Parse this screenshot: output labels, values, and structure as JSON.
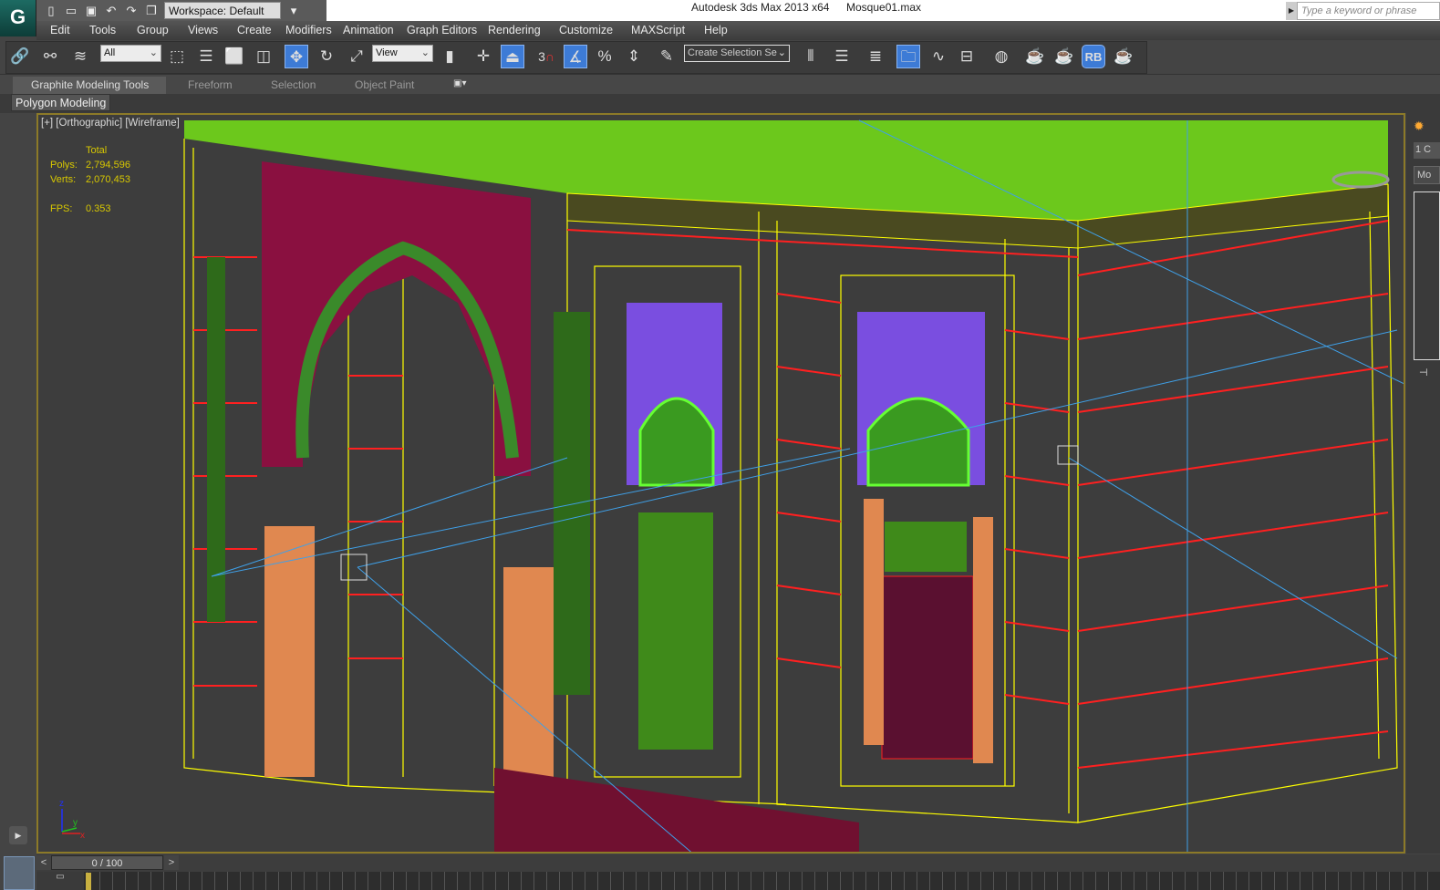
{
  "titlebar": {
    "app_title": "Autodesk 3ds Max  2013 x64",
    "file_name": "Mosque01.max",
    "workspace": "Workspace: Default",
    "search_placeholder": "Type a keyword or phrase"
  },
  "menu": [
    "Edit",
    "Tools",
    "Group",
    "Views",
    "Create",
    "Modifiers",
    "Animation",
    "Graph Editors",
    "Rendering",
    "Customize",
    "MAXScript",
    "Help"
  ],
  "toolbar": {
    "selection_filter": "All",
    "reference_coord": "View",
    "snap_label": "3",
    "named_selection_placeholder": "Create Selection Se",
    "rb_label": "RB"
  },
  "ribbon": {
    "tabs": [
      "Graphite Modeling Tools",
      "Freeform",
      "Selection",
      "Object Paint"
    ],
    "panel": "Polygon Modeling"
  },
  "viewport": {
    "label": "[+] [Orthographic] [Wireframe]",
    "stats": {
      "header": "Total",
      "polys_label": "Polys:",
      "polys": "2,794,596",
      "verts_label": "Verts:",
      "verts": "2,070,453",
      "fps_label": "FPS:",
      "fps": "0.353"
    },
    "axes": {
      "z": "z",
      "y": "y",
      "x": "x"
    }
  },
  "right_panel": {
    "field1": "1 C",
    "field2": "Mo"
  },
  "timeline": {
    "frame": "0 / 100",
    "prev": "<",
    "next": ">"
  },
  "colors": {
    "accent": "#3d7bd6",
    "viewport_border": "#8c7a28",
    "stats": "#d8c800",
    "roof": "#6fcf1f",
    "wire": "#ffff00"
  }
}
